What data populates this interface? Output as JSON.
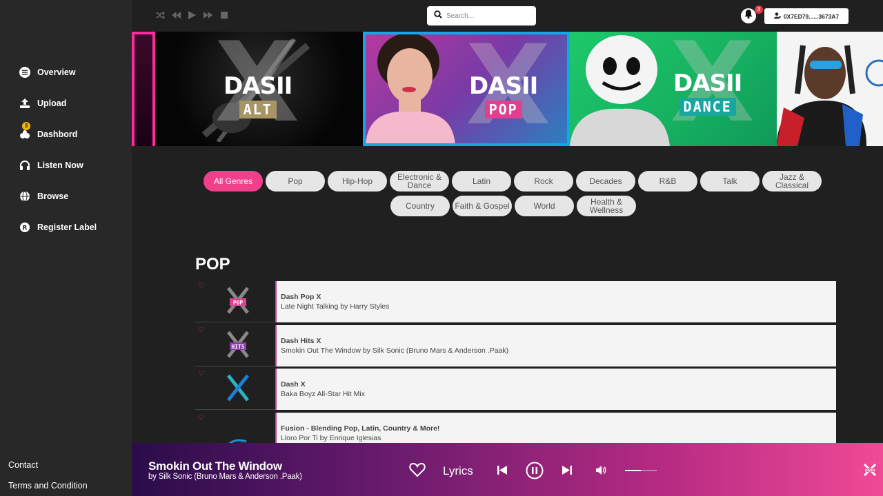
{
  "sidebar": {
    "items": [
      {
        "label": "Overview",
        "icon": "list-icon"
      },
      {
        "label": "Upload",
        "icon": "upload-icon"
      },
      {
        "label": "Dashbord",
        "icon": "dashboard-icon",
        "badge": "3"
      },
      {
        "label": "Listen Now",
        "icon": "headphones-icon"
      },
      {
        "label": "Browse",
        "icon": "globe-icon"
      },
      {
        "label": "Register Label",
        "icon": "registered-icon"
      }
    ],
    "footer": [
      "Contact",
      "Terms and Condition"
    ]
  },
  "topbar": {
    "search_placeholder": "Search...",
    "notification_count": "3",
    "wallet": "0X7ED79......3673A7"
  },
  "banner": {
    "cards": [
      {
        "word": "DASII",
        "sub": "ALT",
        "sub_color": "#a89566"
      },
      {
        "word": "DASII",
        "sub": "POP",
        "sub_color": "#e0408f"
      },
      {
        "word": "DASII",
        "sub": "DANCE",
        "sub_color": "#1aa6a0"
      }
    ]
  },
  "genres": {
    "row1": [
      "All Genres",
      "Pop",
      "Hip-Hop",
      "Electronic & Dance",
      "Latin",
      "Rock",
      "Decades",
      "R&B",
      "Talk",
      "Jazz & Classical"
    ],
    "row2": [
      "Country",
      "Faith & Gospel",
      "World",
      "Health & Wellness"
    ],
    "active": "All Genres"
  },
  "section": {
    "title": "POP",
    "stations": [
      {
        "name": "Dash Pop X",
        "track": "Late Night Talking by Harry Styles",
        "tag": "POP",
        "tag_color": "#e0408f"
      },
      {
        "name": "Dash Hits X",
        "track": "Smokin Out The Window by Silk Sonic (Bruno Mars & Anderson .Paak)",
        "tag": "HITS",
        "tag_color": "#8a3fa8"
      },
      {
        "name": "Dash X",
        "track": "Baka Boyz All-Star Hit Mix",
        "tag": "",
        "tag_color": "#2ab3c7"
      },
      {
        "name": "Fusion - Blending Pop, Latin, Country & More!",
        "track": "Lloro Por Ti by Enrique Iglesias",
        "tag": "",
        "tag_color": "#1e90d6"
      }
    ]
  },
  "player": {
    "title": "Smokin Out The Window",
    "artist": "by Silk Sonic (Bruno Mars & Anderson .Paak)",
    "lyrics_label": "Lyrics",
    "volume": 0.5
  }
}
